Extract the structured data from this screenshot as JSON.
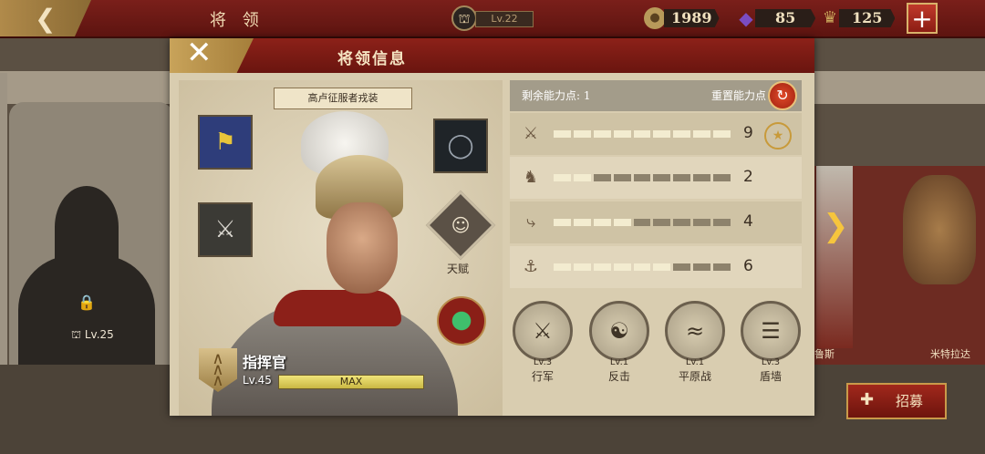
{
  "top": {
    "back_icon": "back-arrow-icon",
    "title": "将 领",
    "level_label": "Lv.22",
    "resources": [
      {
        "name": "coins",
        "icon": "coin-icon",
        "value": "1989",
        "color": "#b89a5a"
      },
      {
        "name": "gems",
        "icon": "purple-gem-icon",
        "value": "85",
        "color": "#7a4cc2"
      },
      {
        "name": "medals",
        "icon": "medal-icon",
        "value": "125",
        "color": "#b89a5a"
      }
    ],
    "add_label": "+"
  },
  "background": {
    "locked_level": "Lv.25",
    "right_names": [
      "鲁斯",
      "米特拉达"
    ],
    "recruit_label": "招募"
  },
  "dialog": {
    "title": "将领信息",
    "skin_tag": "高卢征服者戎装",
    "talent_label": "天赋",
    "rank_name": "指挥官",
    "level": "Lv.45",
    "exp_label": "MAX",
    "exp_fraction": 1.0
  },
  "stats": {
    "remaining_label": "剩余能力点:",
    "remaining_value": "1",
    "reset_label": "重置能力点",
    "rows": [
      {
        "icon": "sword-icon",
        "value": "9",
        "filled": 9
      },
      {
        "icon": "horse-icon",
        "value": "2",
        "filled": 2
      },
      {
        "icon": "bow-icon",
        "value": "4",
        "filled": 4
      },
      {
        "icon": "anchor-icon",
        "value": "6",
        "filled": 6
      }
    ],
    "max_segments": 9
  },
  "skills": [
    {
      "lv": "Lv.3",
      "name": "行军",
      "icon": "march-icon"
    },
    {
      "lv": "Lv.1",
      "name": "反击",
      "icon": "counterattack-icon"
    },
    {
      "lv": "Lv.1",
      "name": "平原战",
      "icon": "plains-icon"
    },
    {
      "lv": "Lv.3",
      "name": "盾墙",
      "icon": "shield-wall-icon"
    }
  ]
}
